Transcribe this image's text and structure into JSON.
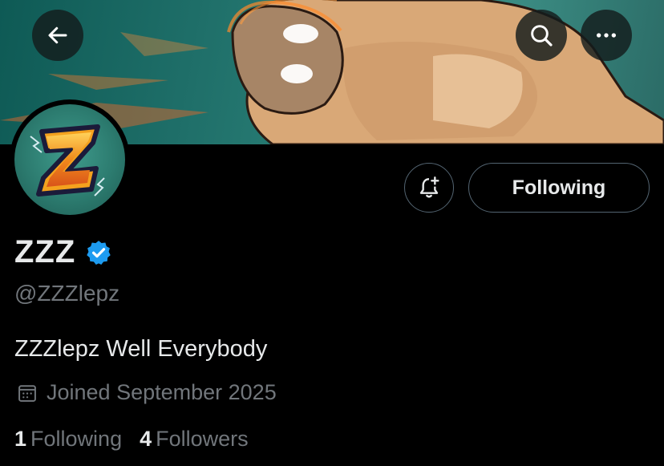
{
  "header": {
    "back_icon": "arrow-left-icon",
    "search_icon": "search-icon",
    "more_icon": "more-horizontal-icon"
  },
  "profile": {
    "display_name": "ZZZ",
    "verified": true,
    "verified_color": "#1d9bf0",
    "handle": "@ZZZlepz",
    "bio": "ZZZlepz Well Everybody",
    "joined": "Joined September 2025",
    "avatar_letter": "Z"
  },
  "actions": {
    "notify_icon": "bell-plus-icon",
    "following_label": "Following"
  },
  "stats": {
    "following_count": "1",
    "following_label": "Following",
    "followers_count": "4",
    "followers_label": "Followers"
  },
  "colors": {
    "background": "#000000",
    "text_primary": "#e7e9ea",
    "text_secondary": "#71767b",
    "border": "#536471"
  }
}
